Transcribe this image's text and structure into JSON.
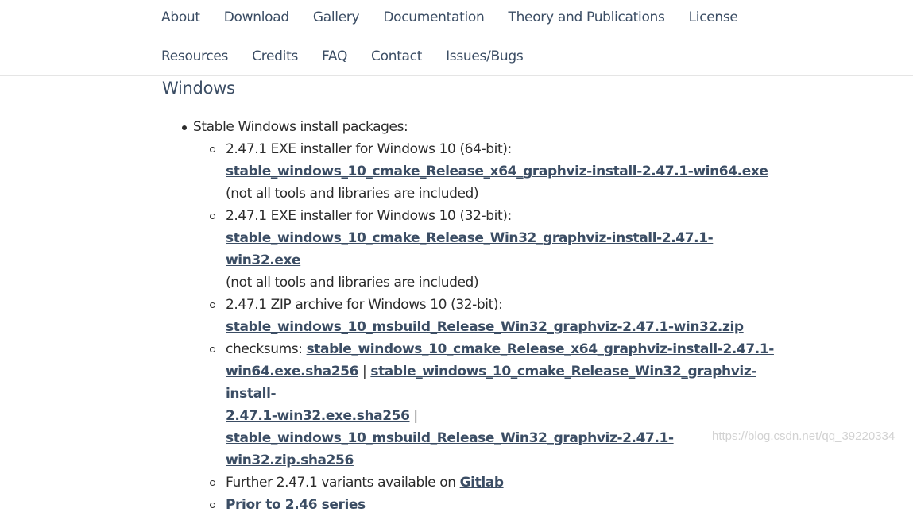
{
  "nav": {
    "row1": [
      "About",
      "Download",
      "Gallery",
      "Documentation",
      "Theory and Publications",
      "License"
    ],
    "row2": [
      "Resources",
      "Credits",
      "FAQ",
      "Contact",
      "Issues/Bugs"
    ]
  },
  "section_title": "Windows",
  "list": {
    "item_label": "Stable Windows install packages:",
    "sub": [
      {
        "text": "2.47.1 EXE installer for Windows 10 (64-bit):",
        "link": "stable_windows_10_cmake_Release_x64_graphviz-install-2.47.1-win64.exe",
        "note": " (not all tools and libraries are included)"
      },
      {
        "text": "2.47.1 EXE installer for Windows 10 (32-bit):",
        "link": "stable_windows_10_cmake_Release_Win32_graphviz-install-2.47.1-win32.exe",
        "note": "(not all tools and libraries are included)"
      },
      {
        "text": "2.47.1 ZIP archive for Windows 10 (32-bit):",
        "link": "stable_windows_10_msbuild_Release_Win32_graphviz-2.47.1-win32.zip"
      }
    ],
    "checksums": {
      "label": "checksums: ",
      "link1": "stable_windows_10_cmake_Release_x64_graphviz-install-2.47.1-win64.exe.sha256",
      "sep1": " | ",
      "link2": "stable_windows_10_cmake_Release_Win32_graphviz-install-2.47.1-win32.exe.sha256",
      "sep2": " |",
      "link3": "stable_windows_10_msbuild_Release_Win32_graphviz-2.47.1-win32.zip.sha256"
    },
    "further": {
      "text": "Further 2.47.1 variants available on ",
      "link": "Gitlab"
    },
    "prior": "Prior to 2.46 series"
  },
  "watermark": "https://blog.csdn.net/qq_39220334"
}
